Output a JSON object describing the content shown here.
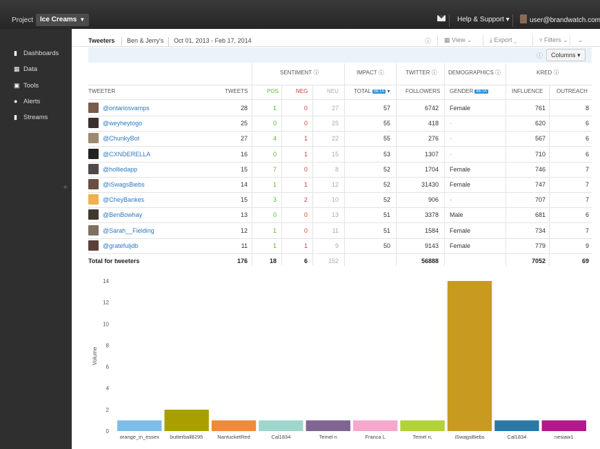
{
  "topbar": {
    "project_label": "Project",
    "project_name": "Ice Creams",
    "help": "Help & Support",
    "user": "user@brandwatch.com"
  },
  "sidebar": {
    "items": [
      {
        "label": "Dashboards",
        "icon": "bar-chart-icon"
      },
      {
        "label": "Data",
        "icon": "grid-icon"
      },
      {
        "label": "Tools",
        "icon": "briefcase-icon"
      },
      {
        "label": "Alerts",
        "icon": "alert-icon"
      },
      {
        "label": "Streams",
        "icon": "stream-icon"
      }
    ],
    "collapse": "«"
  },
  "toolbar": {
    "section": "Tweeters",
    "query": "Ben & Jerry's",
    "date_range": "Oct 01, 2013 - Feb 17, 2014",
    "view": "View",
    "export": "Export",
    "filters": "Filters"
  },
  "subbar": {
    "columns": "Columns"
  },
  "table": {
    "groups": {
      "sentiment": "SENTIMENT",
      "impact": "IMPACT",
      "twitter": "TWITTER",
      "demographics": "DEMOGRAPHICS",
      "kred": "KRED"
    },
    "columns": {
      "tweeter": "TWEETER",
      "tweets": "TWEETS",
      "pos": "POS",
      "neg": "NEG",
      "neu": "NEU",
      "total": "TOTAL",
      "followers": "FOLLOWERS",
      "gender": "GENDER",
      "influence": "INFLUENCE",
      "outreach": "OUTREACH",
      "beta": "BETA"
    },
    "rows": [
      {
        "name": "@ontariosvamps",
        "tweets": "28",
        "pos": "1",
        "neg": "0",
        "neu": "27",
        "total": "57",
        "followers": "6742",
        "gender": "Female",
        "influence": "761",
        "outreach": "8",
        "av": "#7a5a4a"
      },
      {
        "name": "@weyheytogo",
        "tweets": "25",
        "pos": "0",
        "neg": "0",
        "neu": "25",
        "total": "55",
        "followers": "418",
        "gender": "-",
        "influence": "620",
        "outreach": "6",
        "av": "#3a3030"
      },
      {
        "name": "@ChunkyBot",
        "tweets": "27",
        "pos": "4",
        "neg": "1",
        "neu": "22",
        "total": "55",
        "followers": "276",
        "gender": "-",
        "influence": "567",
        "outreach": "6",
        "av": "#9a8a70"
      },
      {
        "name": "@CXNDERELLA",
        "tweets": "16",
        "pos": "0",
        "neg": "1",
        "neu": "15",
        "total": "53",
        "followers": "1307",
        "gender": "-",
        "influence": "710",
        "outreach": "6",
        "av": "#222222"
      },
      {
        "name": "@holliedapp",
        "tweets": "15",
        "pos": "7",
        "neg": "0",
        "neu": "8",
        "total": "52",
        "followers": "1704",
        "gender": "Female",
        "influence": "746",
        "outreach": "7",
        "av": "#504848"
      },
      {
        "name": "@iSwagsBiebs",
        "tweets": "14",
        "pos": "1",
        "neg": "1",
        "neu": "12",
        "total": "52",
        "followers": "31430",
        "gender": "Female",
        "influence": "747",
        "outreach": "7",
        "av": "#6a5040"
      },
      {
        "name": "@CheyBankes",
        "tweets": "15",
        "pos": "3",
        "neg": "2",
        "neu": "10",
        "total": "52",
        "followers": "906",
        "gender": "-",
        "influence": "707",
        "outreach": "7",
        "av": "#f0b050"
      },
      {
        "name": "@BenBowhay",
        "tweets": "13",
        "pos": "0",
        "neg": "0",
        "neu": "13",
        "total": "51",
        "followers": "3378",
        "gender": "Male",
        "influence": "681",
        "outreach": "6",
        "av": "#403830"
      },
      {
        "name": "@Sarah__Fielding",
        "tweets": "12",
        "pos": "1",
        "neg": "0",
        "neu": "11",
        "total": "51",
        "followers": "1584",
        "gender": "Female",
        "influence": "734",
        "outreach": "7",
        "av": "#807060"
      },
      {
        "name": "@gratefuljdb",
        "tweets": "11",
        "pos": "1",
        "neg": "1",
        "neu": "9",
        "total": "50",
        "followers": "9143",
        "gender": "Female",
        "influence": "779",
        "outreach": "9",
        "av": "#5a4038"
      }
    ],
    "totals": {
      "label": "Total for tweeters",
      "tweets": "176",
      "pos": "18",
      "neg": "6",
      "neu": "152",
      "followers": "56888",
      "influence": "7052",
      "outreach": "69"
    }
  },
  "chart_data": {
    "type": "bar",
    "ylabel": "Volume",
    "ylim": [
      0,
      14
    ],
    "yticks": [
      0,
      2,
      4,
      6,
      8,
      10,
      12,
      14
    ],
    "categories": [
      "orange_in_essex",
      "butterball8295",
      "NantucketRed",
      "Cal1834",
      "Temel n",
      "Franca L",
      "Temel n,",
      "iSwagsBiebs",
      "Cal1834",
      "nesiaw1"
    ],
    "values": [
      1,
      2,
      1,
      1,
      1,
      1,
      1,
      14,
      1,
      1
    ],
    "colors": [
      "#7dbde8",
      "#a8a000",
      "#f08a3a",
      "#9ed6cc",
      "#7f6591",
      "#f6a8cc",
      "#b2d236",
      "#c89a20",
      "#2a78a8",
      "#b4188a"
    ],
    "grid": false
  }
}
